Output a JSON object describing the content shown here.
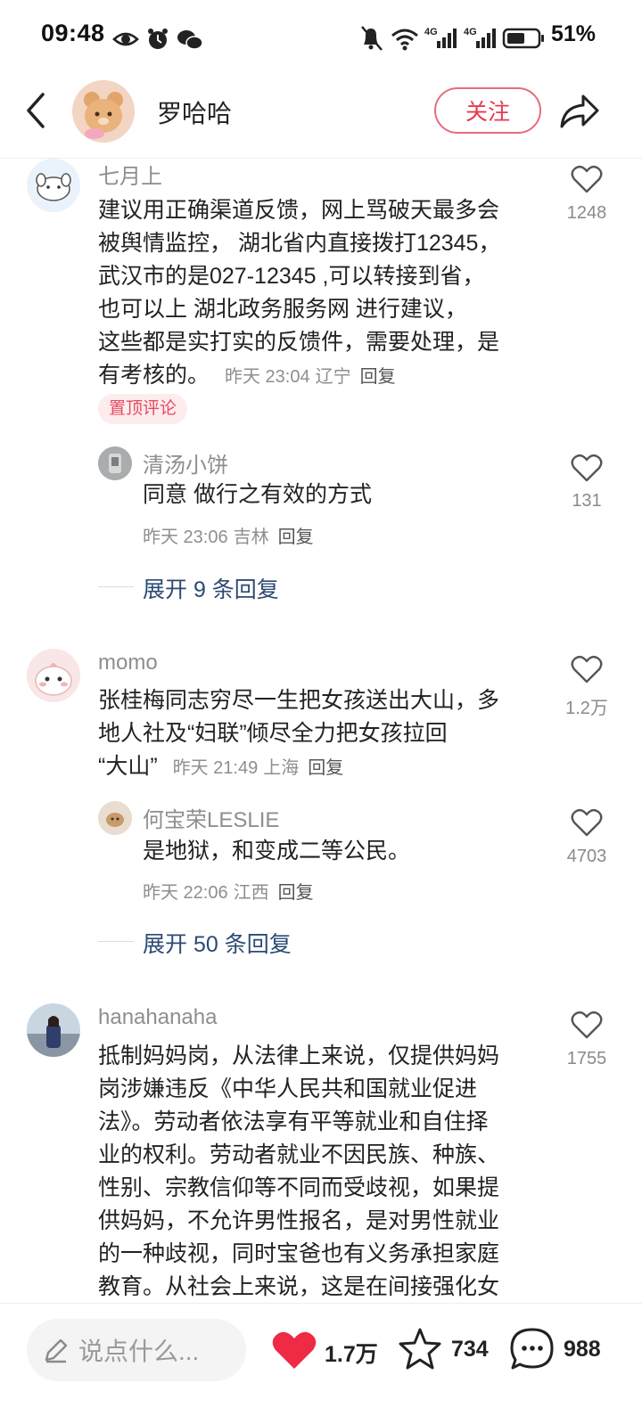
{
  "status_bar": {
    "time": "09:48",
    "battery_pct": "51%"
  },
  "header": {
    "author_name": "罗哈哈",
    "follow_label": "关注"
  },
  "comments": [
    {
      "author": "七月上",
      "lines": [
        "建议用正确渠道反馈，网上骂破天最多会",
        "被舆情监控， 湖北省内直接拨打12345，",
        "武汉市的是027-12345 ,可以转接到省，",
        "也可以上  湖北政务服务网    进行建议，",
        "这些都是实打实的反馈件，需要处理，是",
        "有考核的。"
      ],
      "time": "昨天 23:04",
      "location": "辽宁",
      "reply": "回复",
      "likes": "1248",
      "badge": "置顶评论",
      "sub_reply": {
        "author": "清汤小饼",
        "text": "同意 做行之有效的方式",
        "time": "昨天 23:06",
        "location": "吉林",
        "reply": "回复",
        "likes": "131"
      },
      "expand": "展开 9 条回复"
    },
    {
      "author": "momo",
      "lines": [
        "张桂梅同志穷尽一生把女孩送出大山，多",
        "地人社及“妇联”倾尽全力把女孩拉回",
        "“大山”"
      ],
      "time": "昨天 21:49",
      "location": "上海",
      "reply": "回复",
      "likes": "1.2万",
      "sub_reply": {
        "author": "何宝荣LESLIE",
        "text": "是地狱，和变成二等公民。",
        "time": "昨天 22:06",
        "location": "江西",
        "reply": "回复",
        "likes": "4703"
      },
      "expand": "展开 50 条回复"
    },
    {
      "author": "hanahanaha",
      "lines": [
        "抵制妈妈岗，从法律上来说，仅提供妈妈",
        "岗涉嫌违反《中华人民共和国就业促进",
        "法》。劳动者依法享有平等就业和自住择",
        "业的权利。劳动者就业不因民族、种族、",
        "性别、宗教信仰等不同而受歧视，如果提",
        "供妈妈，不允许男性报名，是对男性就业",
        "的一种歧视，同时宝爸也有义务承担家庭",
        "教育。从社会上来说，这是在间接强化女"
      ],
      "likes": "1755"
    }
  ],
  "bottom_bar": {
    "input_placeholder": "说点什么...",
    "likes": "1.7万",
    "favorites": "734",
    "comments": "988"
  },
  "colors": {
    "accent_red": "#e63950",
    "link_blue": "#2c4a73",
    "meta_gray": "#8e8e8e"
  }
}
